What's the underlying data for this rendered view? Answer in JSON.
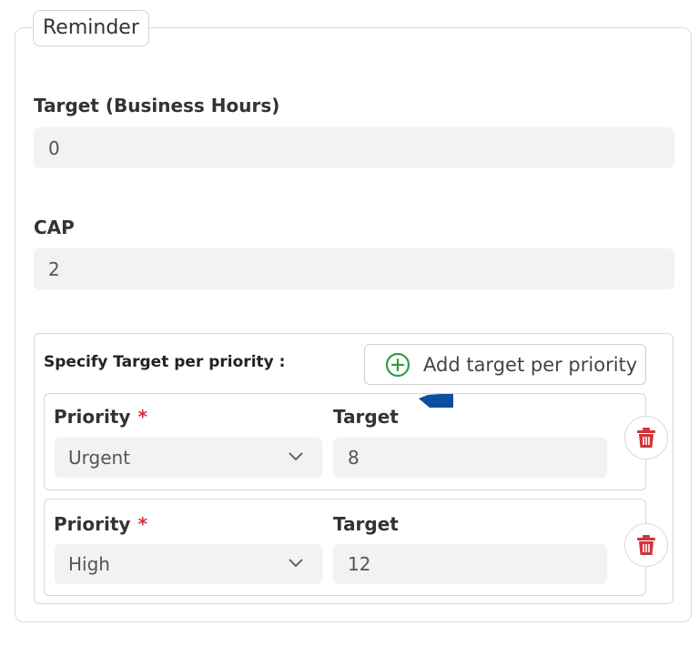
{
  "section": {
    "legend": "Reminder"
  },
  "target_business_hours": {
    "label": "Target (Business Hours)",
    "value": "0"
  },
  "cap": {
    "label": "CAP",
    "value": "2"
  },
  "priority_section": {
    "label": "Specify Target per priority :",
    "add_button_label": "Add target per priority",
    "rows": [
      {
        "priority_label": "Priority",
        "required_marker": "*",
        "priority_value": "Urgent",
        "target_label": "Target",
        "target_value": "8"
      },
      {
        "priority_label": "Priority",
        "required_marker": "*",
        "priority_value": "High",
        "target_label": "Target",
        "target_value": "12"
      }
    ]
  },
  "colors": {
    "accent_green": "#2e9d46",
    "delete_red": "#d13438",
    "required_red": "#d13438",
    "cursor_blue": "#0b4ea2"
  },
  "icons": {
    "add": "plus-circle-icon",
    "delete": "trash-icon",
    "dropdown": "chevron-down-icon"
  }
}
